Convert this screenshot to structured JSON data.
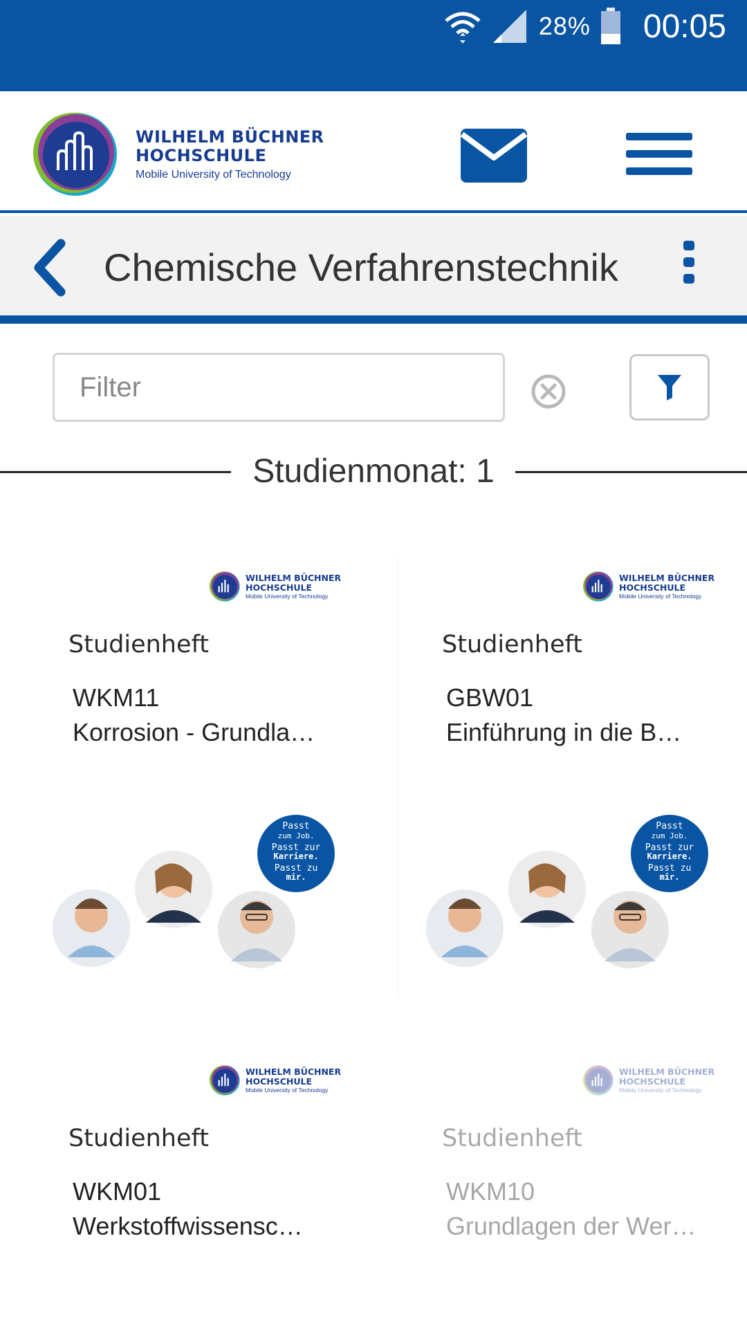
{
  "status_bar": {
    "battery_percent": "28%",
    "time": "00:05",
    "icons": [
      "wifi-icon",
      "signal-icon",
      "battery-icon"
    ]
  },
  "header": {
    "logo": {
      "line1": "WILHELM BÜCHNER",
      "line2": "HOCHSCHULE",
      "line3": "Mobile University of Technology"
    },
    "icons": [
      "mail-icon",
      "hamburger-menu-icon"
    ]
  },
  "title_bar": {
    "title": "Chemische Verfahrenstechnik",
    "icons": [
      "back-chevron-icon",
      "more-vertical-icon"
    ]
  },
  "filter": {
    "placeholder": "Filter",
    "value": "",
    "icons": [
      "clear-icon",
      "funnel-icon"
    ]
  },
  "section": {
    "title": "Studienmonat: 1"
  },
  "cards": [
    {
      "type": "Studienheft",
      "code": "WKM11",
      "name": "Korrosion - Grundla…",
      "has_illustration": true,
      "disabled": false
    },
    {
      "type": "Studienheft",
      "code": "GBW01",
      "name": "Einführung in die B…",
      "has_illustration": true,
      "disabled": false
    },
    {
      "type": "Studienheft",
      "code": "WKM01",
      "name": "Werkstoffwissensc…",
      "has_illustration": false,
      "disabled": false
    },
    {
      "type": "Studienheft",
      "code": "WKM10",
      "name": "Grundlagen der Wer…",
      "has_illustration": false,
      "disabled": true
    }
  ],
  "illustration": {
    "bubble_lines": [
      "Passt",
      "zum Job.",
      "Passt zur",
      "Karriere.",
      "Passt zu",
      "mir."
    ]
  },
  "colors": {
    "brand_blue": "#0a55a3",
    "logo_navy": "#173c8f",
    "title_bar_bg": "#f2f2f2"
  }
}
